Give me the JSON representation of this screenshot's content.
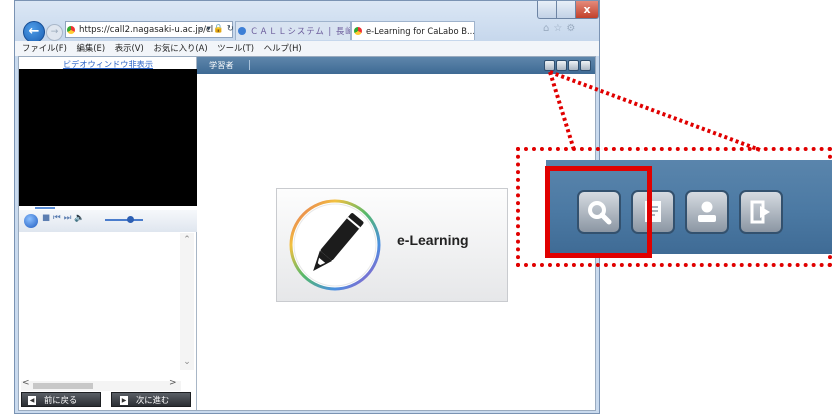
{
  "browser": {
    "url": "https://call2.nagasaki-u.ac.jp/cl",
    "address_tools": "⌕ ▾ 🔒 ↻",
    "tabs": [
      {
        "label": "ＣＡＬＬシステム | 長崎大学"
      },
      {
        "label": "e-Learning for CaLabo B..."
      }
    ],
    "tab_close": "×",
    "close_label": "x",
    "menu": [
      "ファイル(F)",
      "編集(E)",
      "表示(V)",
      "お気に入り(A)",
      "ツール(T)",
      "ヘルプ(H)"
    ],
    "toolbar_icons": [
      "home-icon",
      "star-icon",
      "gear-icon"
    ]
  },
  "left_panel": {
    "video_link": "ビデオウィンドウ非表示",
    "prev_button": "前に戻る",
    "next_button": "次に進む"
  },
  "topbar": {
    "learner_label": "学習者",
    "icons": [
      "search-icon",
      "notes-icon",
      "user-icon",
      "logout-icon"
    ]
  },
  "logo": {
    "text": "e-Learning"
  },
  "callout": {
    "icons": [
      "search-icon",
      "notes-icon",
      "user-icon",
      "logout-icon"
    ],
    "highlighted": "search-icon",
    "colors": {
      "frame": "#e00000",
      "bar": "#4b79a3"
    }
  }
}
